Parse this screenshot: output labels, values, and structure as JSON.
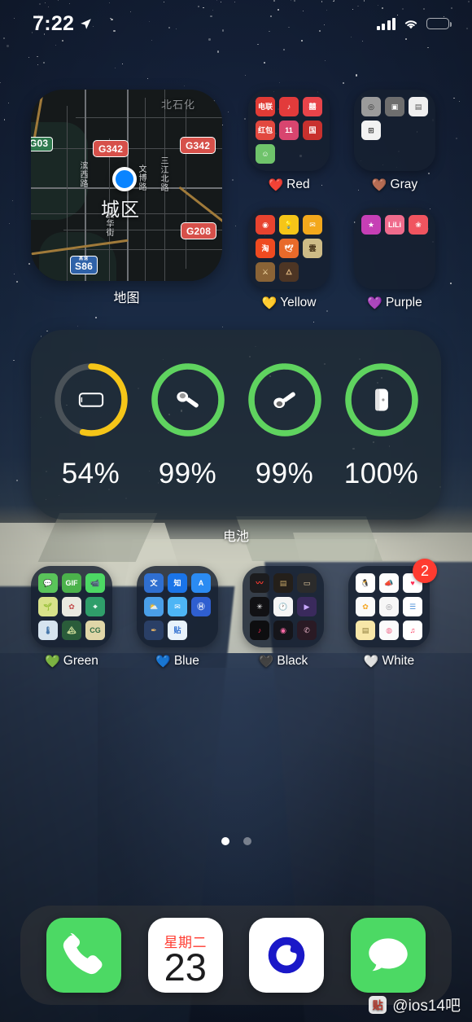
{
  "status_bar": {
    "time": "7:22",
    "location_icon": "location-arrow-icon",
    "cellular_icon": "signal-bars-icon",
    "wifi_icon": "wifi-icon",
    "battery_icon": "battery-icon",
    "battery_level_pct": 54,
    "battery_color": "#f5c518"
  },
  "map_widget": {
    "caption": "地图",
    "city_label": "城区",
    "road_shields": [
      "G342",
      "G342",
      "G208",
      "S86",
      "G03"
    ],
    "street_labels": [
      "滨西路",
      "文博路",
      "三江北路",
      "冀华街",
      "北石化"
    ],
    "user_dot_color": "#0a84ff"
  },
  "folders": [
    {
      "name": "Red",
      "emoji": "❤️",
      "label": "Red",
      "badge": null,
      "apps": [
        {
          "label": "电联",
          "bg": "#e03b35",
          "fg": "#ffffff"
        },
        {
          "label": "♪",
          "bg": "#e23b3b",
          "fg": "#ffffff"
        },
        {
          "label": "囍",
          "bg": "#e8444a",
          "fg": "#ffffff"
        },
        {
          "label": "红包",
          "bg": "#e2483f",
          "fg": "#ffffff"
        },
        {
          "label": "11",
          "bg": "#d8456f",
          "fg": "#ffffff"
        },
        {
          "label": "国",
          "bg": "#c8312e",
          "fg": "#ffffff"
        },
        {
          "label": "☺",
          "bg": "#6fc36b",
          "fg": "#ffffff"
        }
      ]
    },
    {
      "name": "Gray",
      "emoji": "🤎",
      "label": "Gray",
      "badge": null,
      "apps": [
        {
          "label": "◎",
          "bg": "#9b9b9b",
          "fg": "#2b2b2b"
        },
        {
          "label": "▣",
          "bg": "#6e6e6e",
          "fg": "#ffffff"
        },
        {
          "label": "▤",
          "bg": "#efefef",
          "fg": "#555555"
        },
        {
          "label": "⊞",
          "bg": "#f2f2f2",
          "fg": "#333333"
        }
      ]
    },
    {
      "name": "Yellow",
      "emoji": "💛",
      "label": "Yellow",
      "badge": null,
      "apps": [
        {
          "label": "◉",
          "bg": "#e8432f",
          "fg": "#ffffff"
        },
        {
          "label": "💡",
          "bg": "#f5c518",
          "fg": "#ffffff"
        },
        {
          "label": "✉",
          "bg": "#f3a81c",
          "fg": "#ffffff"
        },
        {
          "label": "淘",
          "bg": "#ef4a20",
          "fg": "#ffffff"
        },
        {
          "label": "🕊",
          "bg": "#e86a2a",
          "fg": "#ffffff"
        },
        {
          "label": "雲",
          "bg": "#cdbb86",
          "fg": "#3c2a12"
        },
        {
          "label": "⚔",
          "bg": "#8a6336",
          "fg": "#ffe6b0"
        },
        {
          "label": "🜂",
          "bg": "#4d3524",
          "fg": "#d8b07a"
        }
      ]
    },
    {
      "name": "Purple",
      "emoji": "💜",
      "label": "Purple",
      "badge": null,
      "apps": [
        {
          "label": "★",
          "bg": "#c63fb5",
          "fg": "#ffffff"
        },
        {
          "label": "LiLi",
          "bg": "#ef6b8c",
          "fg": "#ffffff"
        },
        {
          "label": "❀",
          "bg": "#f0545f",
          "fg": "#ffffff"
        }
      ]
    },
    {
      "name": "Green",
      "emoji": "💚",
      "label": "Green",
      "badge": null,
      "apps": [
        {
          "label": "💬",
          "bg": "#5ac45a",
          "fg": "#ffffff"
        },
        {
          "label": "GIF",
          "bg": "#4bb24b",
          "fg": "#ffffff"
        },
        {
          "label": "📹",
          "bg": "#4cd964",
          "fg": "#ffffff"
        },
        {
          "label": "🌱",
          "bg": "#d8e28a",
          "fg": "#3f6b2c"
        },
        {
          "label": "✿",
          "bg": "#e9e9e0",
          "fg": "#c24a4a"
        },
        {
          "label": "⌖",
          "bg": "#2f9e6a",
          "fg": "#ffffff"
        },
        {
          "label": "🌡",
          "bg": "#d6e4ef",
          "fg": "#3a6ea5"
        },
        {
          "label": "🏔",
          "bg": "#2a5c3a",
          "fg": "#d8e6a0"
        },
        {
          "label": "CG",
          "bg": "#e0d6a8",
          "fg": "#2f6b45"
        }
      ]
    },
    {
      "name": "Blue",
      "emoji": "💙",
      "label": "Blue",
      "badge": null,
      "apps": [
        {
          "label": "文",
          "bg": "#2f6fd0",
          "fg": "#ffffff"
        },
        {
          "label": "知",
          "bg": "#1a74e8",
          "fg": "#ffffff"
        },
        {
          "label": "A",
          "bg": "#2b8bf2",
          "fg": "#ffffff"
        },
        {
          "label": "⛅",
          "bg": "#4a9fe8",
          "fg": "#ffffff"
        },
        {
          "label": "✉",
          "bg": "#4db5f5",
          "fg": "#ffffff"
        },
        {
          "label": "Ⓗ",
          "bg": "#2f5fd0",
          "fg": "#ffffff"
        },
        {
          "label": "✒",
          "bg": "#2a3f66",
          "fg": "#e8b464"
        },
        {
          "label": "贴",
          "bg": "#e8f2fb",
          "fg": "#2f6fd0"
        }
      ]
    },
    {
      "name": "Black",
      "emoji": "🖤",
      "label": "Black",
      "badge": null,
      "apps": [
        {
          "label": "〰",
          "bg": "#1c1c1e",
          "fg": "#ff3b30"
        },
        {
          "label": "▤",
          "bg": "#241f1a",
          "fg": "#c8a86a"
        },
        {
          "label": "▭",
          "bg": "#2b2b2b",
          "fg": "#f0d6a8"
        },
        {
          "label": "✳",
          "bg": "#111114",
          "fg": "#ffffff"
        },
        {
          "label": "🕐",
          "bg": "#f5f5f5",
          "fg": "#111111"
        },
        {
          "label": "▶",
          "bg": "#3a2a5c",
          "fg": "#c9a8ff"
        },
        {
          "label": "♪",
          "bg": "#0e0e10",
          "fg": "#ff2d55"
        },
        {
          "label": "◉",
          "bg": "#15151a",
          "fg": "#ff6ba8"
        },
        {
          "label": "✆",
          "bg": "#2a1a24",
          "fg": "#e8b4c8"
        }
      ]
    },
    {
      "name": "White",
      "emoji": "🤍",
      "label": "White",
      "badge": "2",
      "badge_color": "#ff3b30",
      "apps": [
        {
          "label": "🐧",
          "bg": "#ffffff",
          "fg": "#1c1c1e"
        },
        {
          "label": "📣",
          "bg": "#fdfdfd",
          "fg": "#e8a33d"
        },
        {
          "label": "♥",
          "bg": "#ffffff",
          "fg": "#ff2d55"
        },
        {
          "label": "✿",
          "bg": "#fafafa",
          "fg": "#f5a623"
        },
        {
          "label": "◎",
          "bg": "#f7f7f7",
          "fg": "#8e8e93"
        },
        {
          "label": "☰",
          "bg": "#ffffff",
          "fg": "#4a90d9"
        },
        {
          "label": "▤",
          "bg": "#f8e7a8",
          "fg": "#8a7a3a"
        },
        {
          "label": "◍",
          "bg": "#fbfbfb",
          "fg": "#ef6b8c"
        },
        {
          "label": "♫",
          "bg": "#ffffff",
          "fg": "#fa2d55"
        }
      ]
    }
  ],
  "battery_widget": {
    "caption": "电池",
    "ring_green": "#5fd35f",
    "ring_yellow": "#f5c518",
    "ring_track": "#4a5258",
    "devices": [
      {
        "name": "iphone",
        "icon": "iphone-icon",
        "percent": 54,
        "label": "54%",
        "color": "#f5c518",
        "low_power": true
      },
      {
        "name": "airpod-left",
        "icon": "airpod-left-icon",
        "percent": 99,
        "label": "99%",
        "color": "#5fd35f",
        "low_power": false
      },
      {
        "name": "airpod-right",
        "icon": "airpod-right-icon",
        "percent": 99,
        "label": "99%",
        "color": "#5fd35f",
        "low_power": false
      },
      {
        "name": "airpods-case",
        "icon": "airpods-case-icon",
        "percent": 100,
        "label": "100%",
        "color": "#5fd35f",
        "low_power": false
      }
    ]
  },
  "page_dots": {
    "count": 2,
    "active_index": 0
  },
  "dock": {
    "apps": [
      {
        "name": "phone",
        "icon": "phone-icon",
        "bg": "#4cd964"
      },
      {
        "name": "calendar",
        "icon": "calendar-icon",
        "weekday": "星期二",
        "day": "23",
        "bg": "#ffffff"
      },
      {
        "name": "browser",
        "icon": "browser-circle-icon",
        "bg": "#ffffff",
        "accent": "#1a18c8"
      },
      {
        "name": "messages",
        "icon": "messages-icon",
        "bg": "#4cd964"
      }
    ]
  },
  "watermark": {
    "badge": "贴",
    "text": "@ios14吧"
  }
}
